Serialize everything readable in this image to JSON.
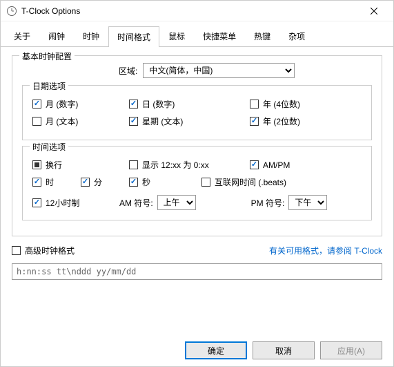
{
  "title": "T-Clock Options",
  "tabs": [
    "关于",
    "闹钟",
    "时钟",
    "时间格式",
    "鼠标",
    "快捷菜单",
    "热键",
    "杂项"
  ],
  "activeTab": 3,
  "basic": {
    "legend": "基本时钟配置",
    "localeLabel": "区域:",
    "localeValue": "中文(简体，中国)",
    "date": {
      "title": "日期选项",
      "monthNum": "月 (数字)",
      "dayNum": "日 (数字)",
      "year4": "年 (4位数)",
      "monthText": "月 (文本)",
      "weekday": "星期 (文本)",
      "year2": "年 (2位数)"
    },
    "time": {
      "title": "时间选项",
      "linebreak": "换行",
      "show12as0": "显示 12:xx 为 0:xx",
      "ampm": "AM/PM",
      "hour": "时",
      "minute": "分",
      "second": "秒",
      "internet": "互联网时间 (.beats)",
      "h12": "12小时制",
      "amLabel": "AM 符号:",
      "amValue": "上午",
      "pmLabel": "PM 符号:",
      "pmValue": "下午"
    }
  },
  "advanced": {
    "label": "高级时钟格式",
    "link": "有关可用格式，请参阅 T-Clock",
    "format": "h:nn:ss tt\\nddd yy/mm/dd"
  },
  "buttons": {
    "ok": "确定",
    "cancel": "取消",
    "apply": "应用(A)"
  }
}
